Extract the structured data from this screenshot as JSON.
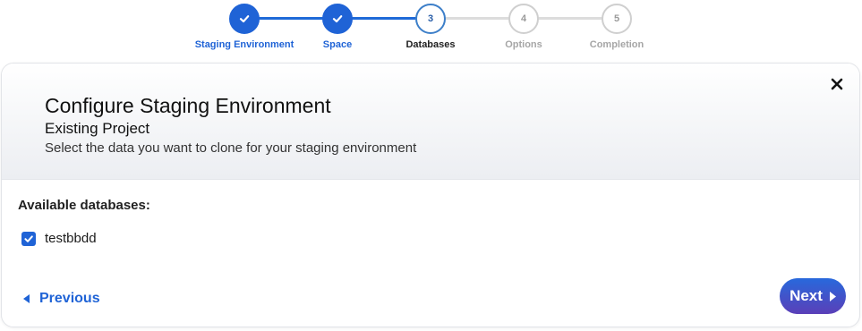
{
  "stepper": {
    "steps": [
      {
        "number": "1",
        "label": "Staging Environment",
        "state": "done"
      },
      {
        "number": "2",
        "label": "Space",
        "state": "done"
      },
      {
        "number": "3",
        "label": "Databases",
        "state": "active"
      },
      {
        "number": "4",
        "label": "Options",
        "state": "todo"
      },
      {
        "number": "5",
        "label": "Completion",
        "state": "todo"
      }
    ]
  },
  "dialog": {
    "title": "Configure Staging Environment",
    "subtitle": "Existing Project",
    "description": "Select the data you want to clone for your staging environment",
    "section_label": "Available databases:",
    "databases": [
      {
        "name": "testbbdd",
        "checked": true
      }
    ],
    "previous_label": "Previous",
    "next_label": "Next"
  },
  "colors": {
    "primary": "#1f63d6",
    "next_gradient_end": "#5a3fb8"
  },
  "icons": {
    "step_done": "check-icon",
    "close": "close-icon",
    "previous": "caret-left-icon",
    "next": "caret-right-icon",
    "checkbox": "check-icon"
  }
}
